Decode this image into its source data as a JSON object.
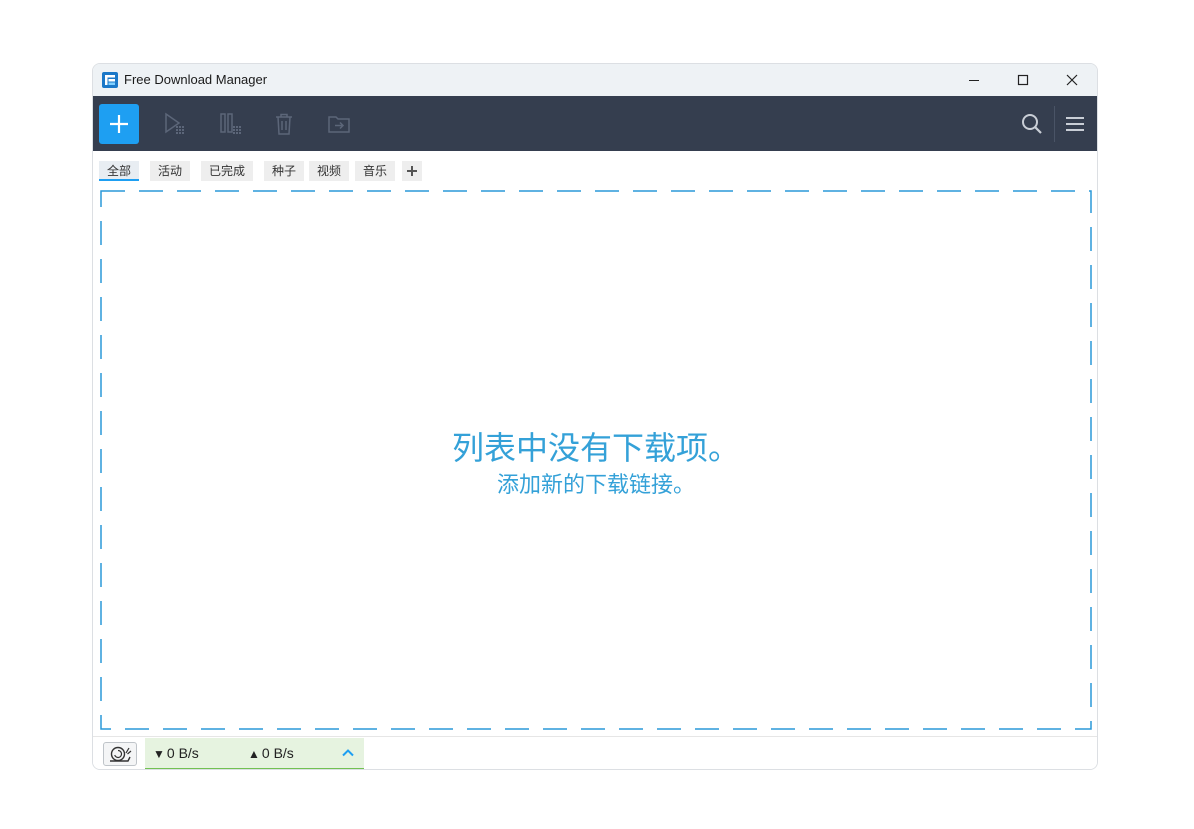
{
  "window": {
    "title": "Free Download Manager",
    "logo_icon": "fdm-logo-icon",
    "controls": [
      "minimize-icon",
      "maximize-icon",
      "close-icon"
    ]
  },
  "toolbar": {
    "buttons": [
      {
        "name": "add-download",
        "icon": "plus-icon",
        "enabled": true
      },
      {
        "name": "resume",
        "icon": "play-icon",
        "enabled": false
      },
      {
        "name": "pause",
        "icon": "pause-icon",
        "enabled": false
      },
      {
        "name": "delete",
        "icon": "trash-icon",
        "enabled": false
      },
      {
        "name": "move",
        "icon": "folder-move-icon",
        "enabled": false
      }
    ],
    "right": [
      "search-icon",
      "menu-icon"
    ]
  },
  "tabs": [
    {
      "label": "全部",
      "active": true
    },
    {
      "label": "活动",
      "active": false
    },
    {
      "label": "已完成",
      "active": false
    },
    {
      "label": "种子",
      "active": false
    },
    {
      "label": "视频",
      "active": false
    },
    {
      "label": "音乐",
      "active": false
    }
  ],
  "tab_add_icon": "plus-icon",
  "empty_state": {
    "title": "列表中没有下载项。",
    "subtitle": "添加新的下载链接。"
  },
  "statusbar": {
    "snail_icon": "snail-icon",
    "download_arrow": "▼",
    "download_speed": "0 B/s",
    "upload_arrow": "▲",
    "upload_speed": "0 B/s",
    "expand_icon": "chevron-up-icon"
  },
  "colors": {
    "accent": "#1e9ff2",
    "toolbar_bg": "#353e4f",
    "empty_text": "#34a1d8",
    "speed_panel_bg": "#e6f3e0",
    "speed_panel_border": "#72c152"
  }
}
